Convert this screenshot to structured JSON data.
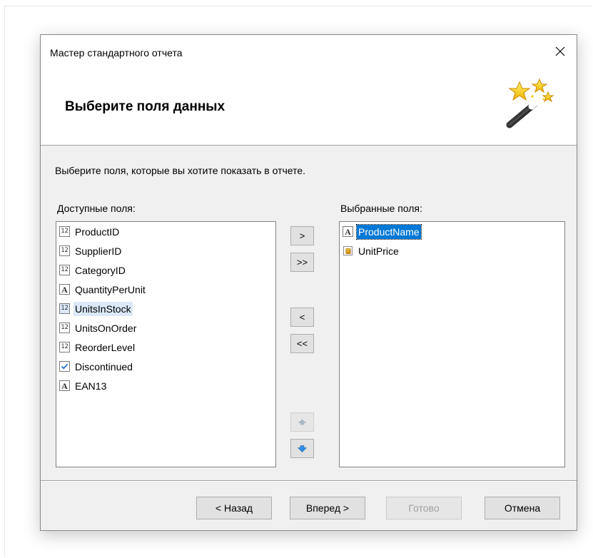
{
  "window": {
    "title": "Мастер стандартного отчета",
    "close_glyph": "✕"
  },
  "header": {
    "title": "Выберите поля данных",
    "icon": "magic-wand-icon"
  },
  "instruction": "Выберите поля, которые вы хотите показать в отчете.",
  "available": {
    "label": "Доступные поля:",
    "items": [
      {
        "name": "ProductID",
        "type": "number",
        "state": "normal"
      },
      {
        "name": "SupplierID",
        "type": "number",
        "state": "normal"
      },
      {
        "name": "CategoryID",
        "type": "number",
        "state": "normal"
      },
      {
        "name": "QuantityPerUnit",
        "type": "text",
        "state": "normal"
      },
      {
        "name": "UnitsInStock",
        "type": "number",
        "state": "hover"
      },
      {
        "name": "UnitsOnOrder",
        "type": "number",
        "state": "normal"
      },
      {
        "name": "ReorderLevel",
        "type": "number",
        "state": "normal"
      },
      {
        "name": "Discontinued",
        "type": "boolean",
        "state": "normal"
      },
      {
        "name": "EAN13",
        "type": "text",
        "state": "normal"
      }
    ]
  },
  "selected": {
    "label": "Выбранные поля:",
    "items": [
      {
        "name": "ProductName",
        "type": "text",
        "state": "selected"
      },
      {
        "name": "UnitPrice",
        "type": "currency",
        "state": "normal"
      }
    ]
  },
  "move_buttons": {
    "add": ">",
    "add_all": ">>",
    "remove": "<",
    "remove_all": "<<",
    "up_icon": "arrow-up-icon",
    "down_icon": "arrow-down-icon"
  },
  "footer": {
    "back": "< Назад",
    "next": "Вперед >",
    "finish": "Готово",
    "cancel": "Отмена"
  },
  "colors": {
    "selection": "#0078d7",
    "hover": "#dbe9f8",
    "dialog_bg": "#f0f0f0",
    "arrow_blue": "#2f8fe6"
  },
  "type_icons": {
    "number": "number-type-icon",
    "text": "text-type-icon",
    "boolean": "checkbox-type-icon",
    "currency": "currency-type-icon"
  },
  "type_icon_glyphs": {
    "number": "12",
    "text": "A"
  }
}
